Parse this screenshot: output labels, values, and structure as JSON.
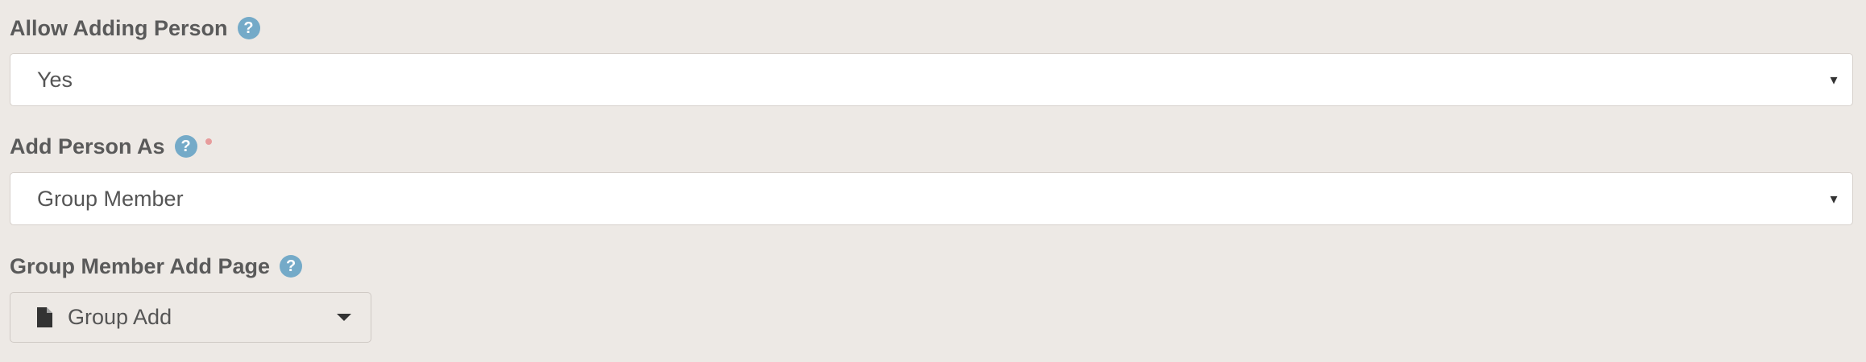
{
  "allow_adding_person": {
    "label": "Allow Adding Person",
    "help_icon": "?",
    "selected_value": "Yes",
    "arrow": "▾"
  },
  "add_person_as": {
    "label": "Add Person As",
    "help_icon": "?",
    "required": true,
    "selected_value": "Group Member",
    "arrow": "▾"
  },
  "group_member_add_page": {
    "label": "Group Member Add Page",
    "help_icon": "?",
    "icon": "file-icon",
    "selected_value": "Group Add"
  },
  "colors": {
    "background": "#ede9e5",
    "help_icon": "#74aac8",
    "required_dot": "#e79c9c",
    "input_border": "#d6d0cb"
  }
}
